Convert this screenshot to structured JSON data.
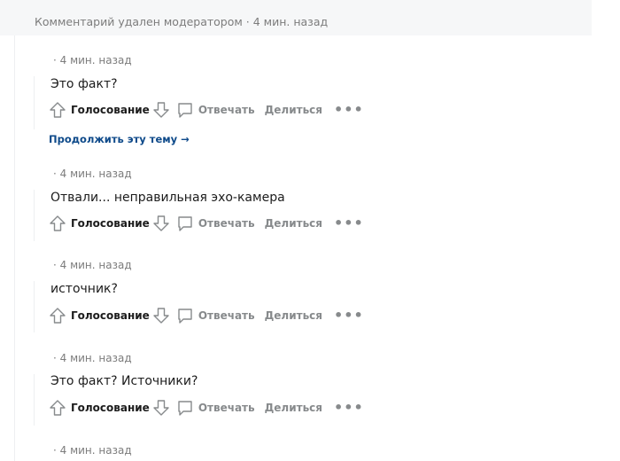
{
  "deleted": {
    "text": "Комментарий удален модератором · 4 мин. назад"
  },
  "actions": {
    "vote_label": "Голосование",
    "reply_label": "Отвечать",
    "share_label": "Делиться",
    "more_label": "•••"
  },
  "continue_thread": {
    "label": "Продолжить эту тему →"
  },
  "comments": [
    {
      "meta": "· 4 мин. назад",
      "text": "Это факт?"
    },
    {
      "meta": "· 4 мин. назад",
      "text": "Отвали... неправильная эхо-камера"
    },
    {
      "meta": "· 4 мин. назад",
      "text": "источник?"
    },
    {
      "meta": "· 4 мин. назад",
      "text": "Это факт? Источники?"
    },
    {
      "meta": "· 4 мин. назад",
      "text": ""
    }
  ],
  "colors": {
    "link": "#0e4a8a",
    "muted": "#7c7c7c",
    "action": "#878a8c",
    "deleted_bg": "#f6f7f8"
  },
  "icons": [
    "upvote-icon",
    "downvote-icon",
    "reply-bubble-icon",
    "more-dots-icon",
    "arrow-right-icon"
  ]
}
